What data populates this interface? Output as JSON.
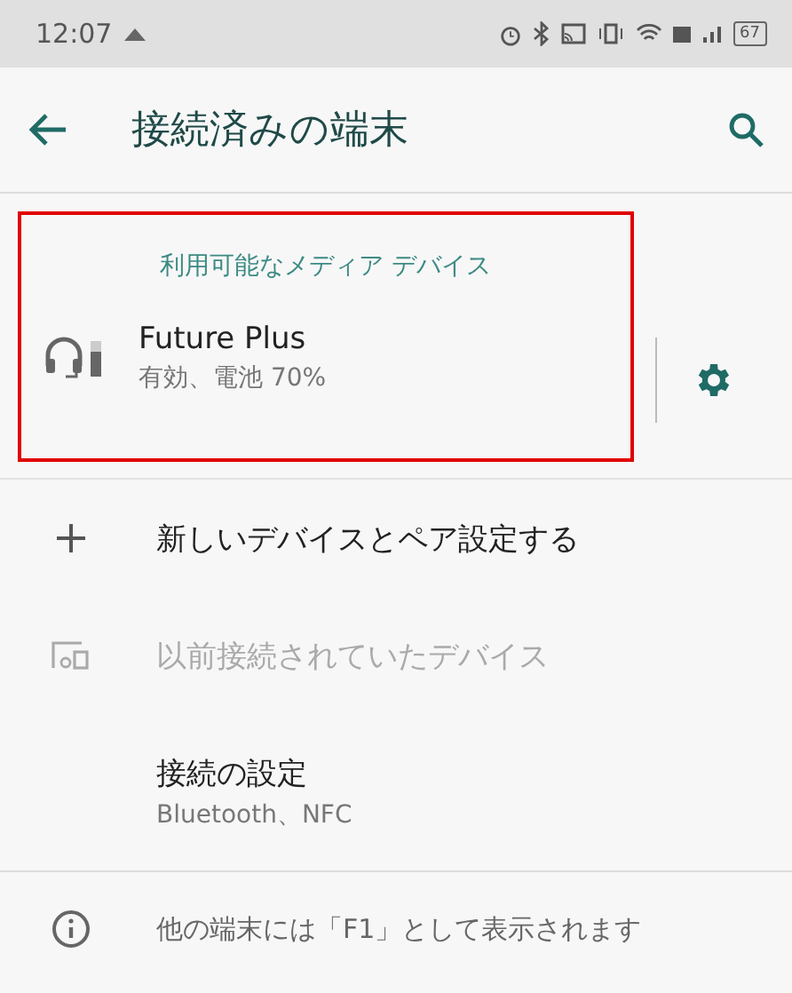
{
  "status_bar": {
    "time": "12:07",
    "battery": "67"
  },
  "app_bar": {
    "title": "接続済みの端末"
  },
  "media_section": {
    "header": "利用可能なメディア デバイス",
    "device": {
      "name": "Future Plus",
      "status": "有効、電池 70%"
    }
  },
  "items": [
    {
      "kind": "add",
      "title": "新しいデバイスとペア設定する",
      "disabled": false
    },
    {
      "kind": "previous",
      "title": "以前接続されていたデバイス",
      "disabled": true
    },
    {
      "kind": "plain",
      "title": "接続の設定",
      "summary": "Bluetooth、NFC",
      "disabled": false
    }
  ],
  "footer": {
    "text": "他の端末には「F1」として表示されます"
  }
}
